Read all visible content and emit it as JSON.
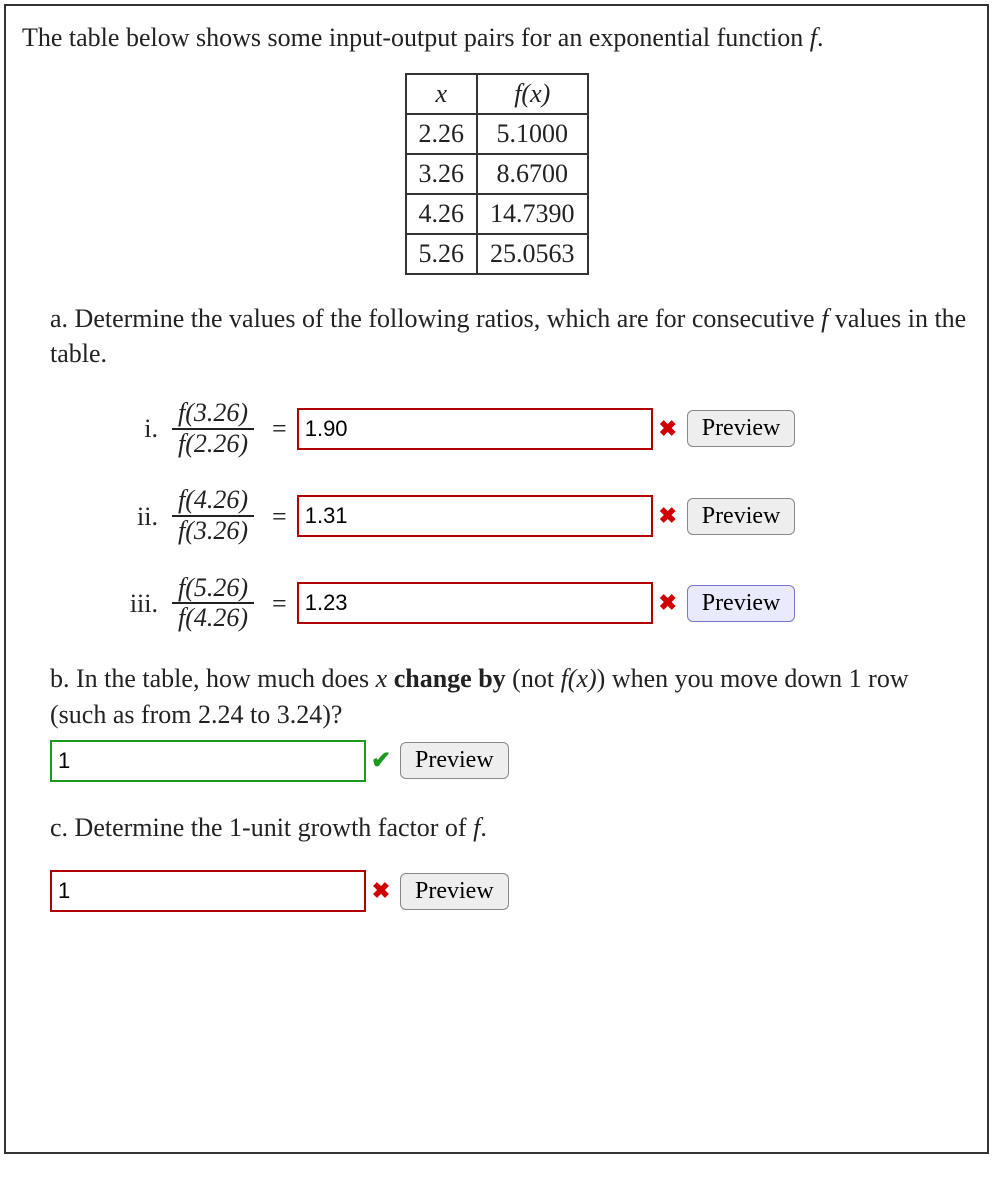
{
  "intro_prefix": "The table below shows some input-output pairs for an exponential function ",
  "intro_fn": "f",
  "intro_suffix": ".",
  "table": {
    "header_x": "x",
    "header_fx": "f(x)",
    "rows": [
      {
        "x": "2.26",
        "fx": "5.1000"
      },
      {
        "x": "3.26",
        "fx": "8.6700"
      },
      {
        "x": "4.26",
        "fx": "14.7390"
      },
      {
        "x": "5.26",
        "fx": "25.0563"
      }
    ]
  },
  "part_a": {
    "label": "a.",
    "text_prefix": " Determine the values of the following ratios, which are for consecutive ",
    "fn": "f",
    "text_suffix": " values in the table.",
    "items": [
      {
        "roman": "i.",
        "num": "f(3.26)",
        "den": "f(2.26)",
        "value": "1.90",
        "correct": false
      },
      {
        "roman": "ii.",
        "num": "f(4.26)",
        "den": "f(3.26)",
        "value": "1.31",
        "correct": false
      },
      {
        "roman": "iii.",
        "num": "f(5.26)",
        "den": "f(4.26)",
        "value": "1.23",
        "correct": false,
        "hover": true
      }
    ]
  },
  "part_b": {
    "label": "b.",
    "text1": " In the table, how much does ",
    "xvar": "x",
    "text2": " ",
    "bold": "change by",
    "text3": " (not ",
    "fx": "f(x)",
    "text4": ") when you move down 1 row (such as from 2.24 to 3.24)?",
    "value": "1",
    "correct": true
  },
  "part_c": {
    "label": "c.",
    "text_prefix": " Determine the 1-unit growth factor of ",
    "fn": "f",
    "text_suffix": ".",
    "value": "1",
    "correct": false
  },
  "preview_label": "Preview",
  "chart_data": {
    "type": "table",
    "title": "Input-output pairs for exponential function f",
    "columns": [
      "x",
      "f(x)"
    ],
    "rows": [
      [
        2.26,
        5.1
      ],
      [
        3.26,
        8.67
      ],
      [
        4.26,
        14.739
      ],
      [
        5.26,
        25.0563
      ]
    ]
  }
}
